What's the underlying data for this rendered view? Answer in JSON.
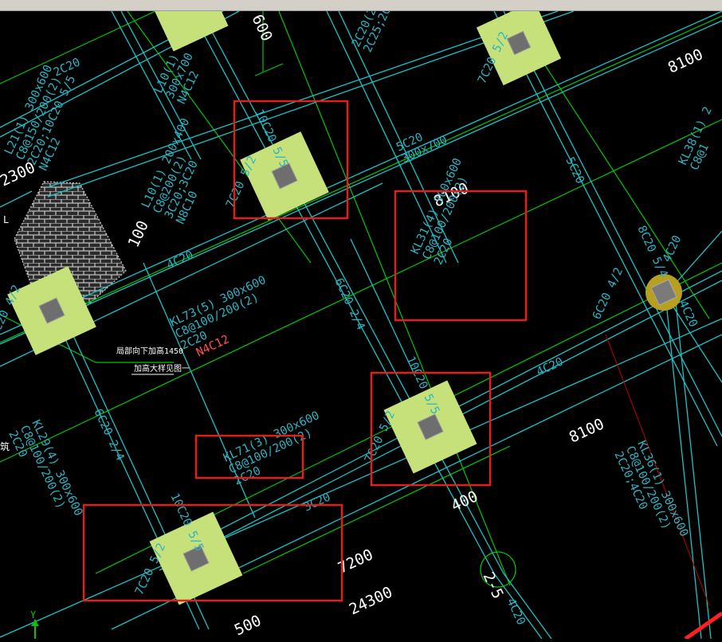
{
  "app": {
    "type": "CAD drawing canvas"
  },
  "colors": {
    "background": "#000000",
    "beam": "#17c4c9",
    "axis": "#00c800",
    "text": "#2bb5c4",
    "column_fill": "#c6e07a",
    "column_core": "#6e6e6e",
    "highlight": "#e0201a",
    "red_text": "#ff5050",
    "white_text": "#ffffff"
  },
  "annotations": {
    "kl31_1": "KL31(4) 300x600",
    "kl31_2": "C8@100/200(2)",
    "kl31_3": "2C20",
    "kl73_1": "KL73(5) 300x600",
    "kl73_2": "C8@100/200(2)",
    "kl73_3": "2C20",
    "kl73_4": "N4C12",
    "kl71_1": "KL71(3) 300x600",
    "kl71_2": "C8@100/200(2)",
    "kl71_3": "2C20",
    "kl29_1": "KL29(4) 300x600",
    "kl29_2": "C8@100/200(2)",
    "kl29_3": "2C20",
    "kl36_1": "KL36(1) 300x600",
    "kl36_2": "C8@100/200(2)",
    "kl36_3": "2C20;4C20",
    "kl38_1": "KL38(1) 2",
    "kl38_2": "C8@1",
    "kl21_1": "L21(1) 300x600",
    "kl21_2": "C8@150/200(2)",
    "kl21_3": "2C20;10C20 5/5",
    "kl21_4": "N4C12",
    "l10_1": "L10(1) 200x400",
    "l10_2": "C8@200(2)",
    "l10_3": "3C20;3C20",
    "l10_4": "N8C10",
    "l_top_1": "L10(1)",
    "l_top_2": "300x700",
    "l_top_3": "N4C12",
    "l_right_top_1": "2C20(2) 300x600",
    "l_right_top_2": "2C25;2C20",
    "lb_1": "5C20",
    "lb_2": "300x700",
    "dim_8100_a": "8100",
    "dim_8100_b": "8100",
    "dim_8100_c": "8100",
    "dim_2300": "2300",
    "dim_100": "100",
    "dim_7200": "7200",
    "dim_24300": "24300",
    "dim_400": "400",
    "dim_500": "500",
    "dim_600_top": "600",
    "rebar_10c20_a": "10C20 5/5",
    "rebar_7c20_a": "7C20 5/2",
    "rebar_10c20_b": "10C20 5/5",
    "rebar_7c20_b": "7C20 5/2",
    "rebar_10c20_c": "10C20 5/5",
    "rebar_7c20_c": "7C20 5/2",
    "rebar_7c20_d": "7C20 5/2",
    "rebar_6c20_a": "6C20 2/4",
    "rebar_6c20_b": "6C20 2/4",
    "rebar_6c20_c": "6C20 4/2",
    "rebar_4c20_a": "4C20",
    "rebar_4c20_b": "4C20",
    "rebar_4c20_c": "4C20",
    "rebar_3c20": "3C20",
    "rebar_5c20": "5C20",
    "rebar_8c20": "8C20 5/4",
    "rebar_4c20_right": "4C20",
    "rebar_4c20_rb": "4C20",
    "rebar_4c20_left": "C20 4/2",
    "rebar_2c20": "2C20",
    "note_cn_1": "局部向下加高1450",
    "note_cn_2": "加高大样见图一",
    "note_value": "1450",
    "axis_label": "2-5",
    "left_char": "筑",
    "l_char": "L",
    "y_axis": "Y"
  }
}
